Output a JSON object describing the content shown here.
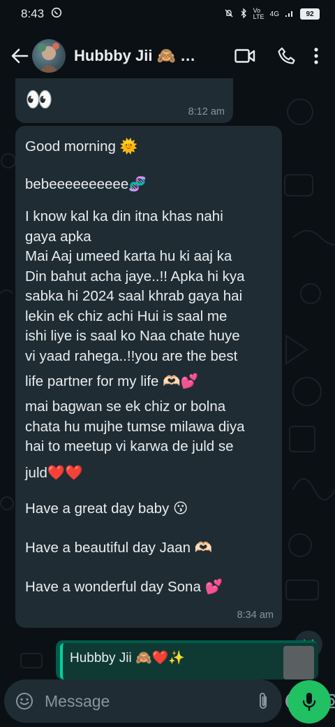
{
  "status_bar": {
    "time": "8:43",
    "network": "4G",
    "volte": "Vo LTE",
    "battery": "92"
  },
  "header": {
    "contact_name": "Hubbby Jii 🙈 …",
    "icons": [
      "back-arrow-icon",
      "video-call-icon",
      "voice-call-icon",
      "more-options-icon"
    ]
  },
  "messages": [
    {
      "text": "👀",
      "time": "8:12 am"
    },
    {
      "lines": [
        "Good morning 🌞",
        "",
        "bebeeeeeeeeee🧬",
        "",
        "I know kal ka din itna khas nahi",
        "gaya apka",
        "Mai Aaj umeed karta hu ki aaj ka",
        "Din bahut acha jaye..!! Apka hi kya",
        "sabka hi 2024 saal khrab gaya hai",
        "lekin ek chiz achi Hui is saal me",
        "ishi liye is saal ko Naa chate huye",
        "vi yaad rahega..!!you are the best",
        "life partner for my life 🫶🏻💕",
        "mai bagwan se ek chiz or bolna",
        "chata hu mujhe tumse milawa diya",
        "hai to meetup vi karwa de juld se",
        "juld❤️❤️",
        "Have a great day baby 😗",
        "Have a beautiful day Jaan 🫶🏻",
        "Have a wonderful day Sona 💕"
      ],
      "time": "8:34 am"
    }
  ],
  "reply_preview": {
    "name": "Hubbby Jii 🙈❤️✨"
  },
  "composer": {
    "placeholder": "Message"
  },
  "colors": {
    "background": "#0b1014",
    "bubble": "#1f2c34",
    "accent": "#21c063",
    "secondary_text": "#8696a0"
  }
}
